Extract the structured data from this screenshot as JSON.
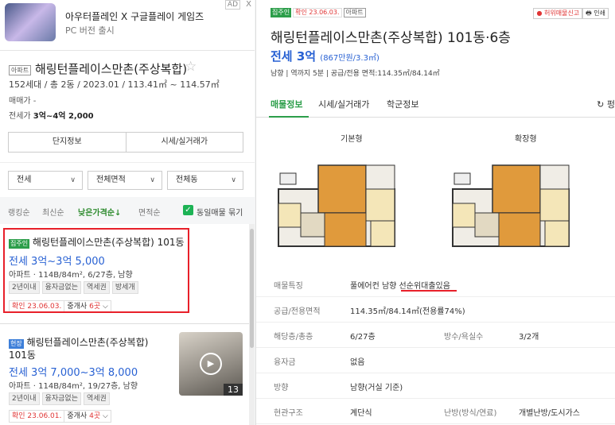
{
  "ad": {
    "title": "아우터플레인 X 구글플레이 게임즈",
    "subtitle": "PC 버전 출시",
    "badge": "AD",
    "close": "X"
  },
  "complex": {
    "tag": "아파트",
    "name": "해링턴플레이스만촌(주상복합)",
    "star": "☆",
    "info": "152세대 / 총 2동 / 2023.01 / 113.41㎡ ~ 114.57㎡",
    "sale_label": "매매가 -",
    "jeonse_label": "전세가",
    "jeonse_value": "3억~4억 2,000",
    "btn_info": "단지정보",
    "btn_price": "시세/실거래가"
  },
  "filters": {
    "type": "전세",
    "area": "전체면적",
    "dong": "전체동"
  },
  "sort": {
    "opt1": "랭킹순",
    "opt2": "최신순",
    "opt3": "낮은가격순↓",
    "opt4": "면적순",
    "same": "동일매물 묶기"
  },
  "listings": [
    {
      "tag": "집주인",
      "title": "해링턴플레이스만촌(주상복합) 101동",
      "price": "전세 3억~3억 5,000",
      "spec": "아파트 · 114B/84m², 6/27층, 남향",
      "chips": [
        "2년이내",
        "융자금없는",
        "역세권",
        "방세개"
      ],
      "date": "확인 23.06.03.",
      "agents_pre": "중개사",
      "agents_n": "6곳",
      "agents_post": "⌵"
    },
    {
      "tag": "현장",
      "title1": "해링턴플레이스만촌(주상복합)",
      "title2": "101동",
      "price": "전세 3억 7,000~3억 8,000",
      "spec": "아파트 · 114B/84m², 19/27층, 남향",
      "chips": [
        "2년이내",
        "융자금없는",
        "역세권"
      ],
      "date": "확인 23.06.01.",
      "agents_pre": "중개사",
      "agents_n": "4곳",
      "agents_post": "⌵",
      "photo_count": "13"
    }
  ],
  "detail": {
    "tag_owner": "집주인",
    "tag_date": "확인 23.06.03.",
    "tag_type": "아파트",
    "report": "● 허위매물신고",
    "print": "🖶 인쇄",
    "title": "해링턴플레이스만촌(주상복합) 101동·6층",
    "price": "전세 3억",
    "price_sub": "(867만원/3.3㎡)",
    "meta": "남향 | 역까지 5분 | 공급/전용 면적:114.35㎡/84.14㎡",
    "tab1": "매물정보",
    "tab2": "시세/실거래가",
    "tab3": "학군정보",
    "refresh": "↻ 펑",
    "fp_basic": "기본형",
    "fp_ext": "확장형",
    "rows": [
      {
        "k": "매물특징",
        "v": "풀에어컨 남향 선순위대출있음"
      },
      {
        "k": "공급/전용면적",
        "v": "114.35㎡/84.14㎡(전용률74%)"
      },
      {
        "k": "해당층/총층",
        "v": "6/27층",
        "k2": "방수/욕실수",
        "v2": "3/2개"
      },
      {
        "k": "융자금",
        "v": "없음"
      },
      {
        "k": "방향",
        "v": "남향(거실 기준)"
      },
      {
        "k": "현관구조",
        "v": "계단식",
        "k2": "난방(방식/연료)",
        "v2": "개별난방/도시가스"
      }
    ]
  },
  "colors": {
    "accent": "#2c9e4a",
    "price": "#2861d3",
    "highlight": "#e8202a"
  }
}
